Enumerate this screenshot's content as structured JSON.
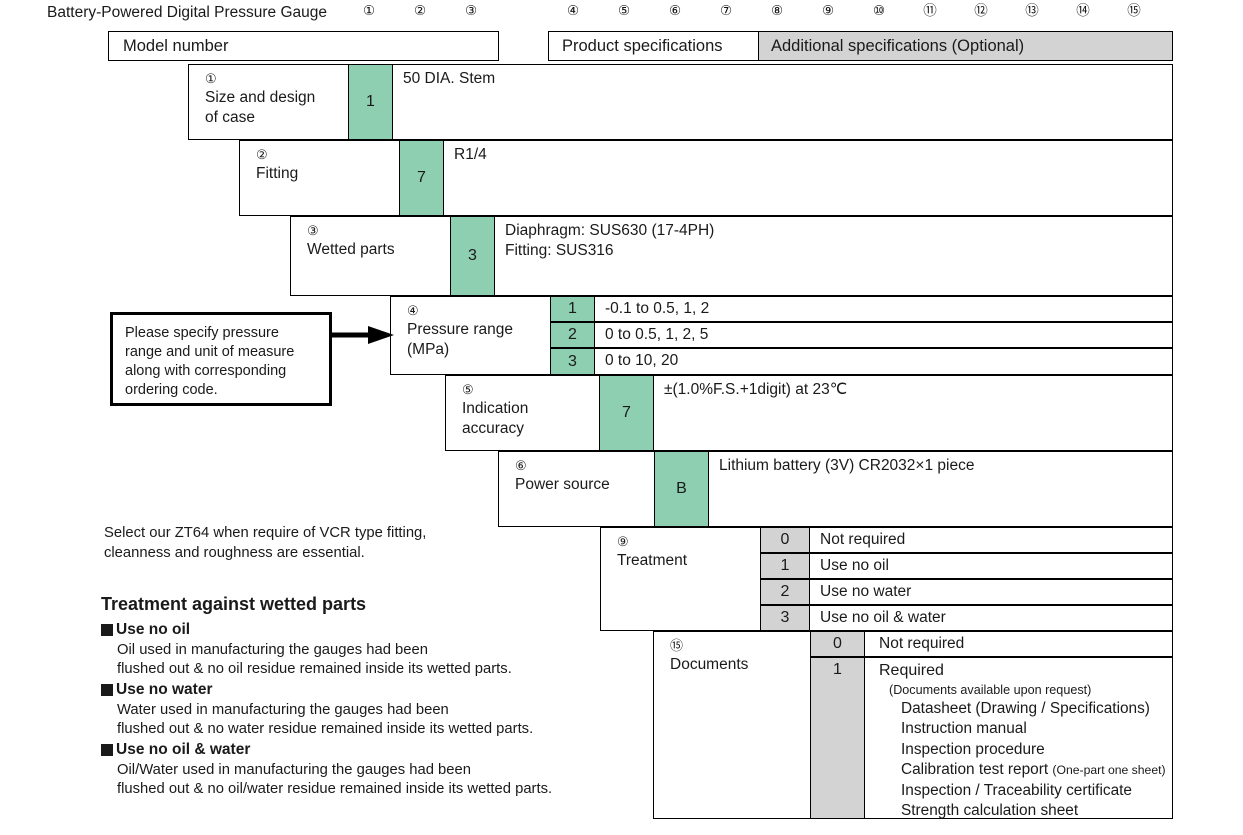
{
  "header": {
    "title": "Battery-Powered Digital Pressure Gauge",
    "circled_markers": [
      "①",
      "②",
      "③",
      "④",
      "⑤",
      "⑥",
      "⑦",
      "⑧",
      "⑨",
      "⑩",
      "⑪",
      "⑫",
      "⑬",
      "⑭",
      "⑮"
    ],
    "model_number_label": "Model number",
    "product_specifications_label": "Product specifications",
    "additional_specifications_label": "Additional specifications (Optional)"
  },
  "colors": {
    "code_green": "#8ecfb2",
    "code_gray": "#d3d3d3",
    "border": "#000000"
  },
  "spec_rows": [
    {
      "marker": "①",
      "label": "Size and design\nof case",
      "code_style": "green",
      "options": [
        {
          "code": "1",
          "desc": "50 DIA. Stem"
        }
      ]
    },
    {
      "marker": "②",
      "label": "Fitting",
      "code_style": "green",
      "options": [
        {
          "code": "7",
          "desc": "R1/4"
        }
      ]
    },
    {
      "marker": "③",
      "label": "Wetted parts",
      "code_style": "green",
      "options": [
        {
          "code": "3",
          "desc": "Diaphragm: SUS630 (17-4PH)\nFitting: SUS316"
        }
      ]
    },
    {
      "marker": "④",
      "label": "Pressure range\n(MPa)",
      "code_style": "green",
      "options": [
        {
          "code": "1",
          "desc": "-0.1 to 0.5, 1, 2"
        },
        {
          "code": "2",
          "desc": "0 to 0.5, 1, 2, 5"
        },
        {
          "code": "3",
          "desc": "0 to 10, 20"
        }
      ]
    },
    {
      "marker": "⑤",
      "label": "Indication\naccuracy",
      "code_style": "green",
      "options": [
        {
          "code": "7",
          "desc": "±(1.0%F.S.+1digit) at 23℃"
        }
      ]
    },
    {
      "marker": "⑥",
      "label": "Power source",
      "code_style": "green",
      "options": [
        {
          "code": "B",
          "desc": "Lithium battery (3V) CR2032×1 piece"
        }
      ]
    },
    {
      "marker": "⑨",
      "label": "Treatment",
      "code_style": "gray",
      "options": [
        {
          "code": "0",
          "desc": "Not required"
        },
        {
          "code": "1",
          "desc": "Use no oil"
        },
        {
          "code": "2",
          "desc": "Use no water"
        },
        {
          "code": "3",
          "desc": "Use no oil & water"
        }
      ]
    }
  ],
  "documents_row": {
    "marker": "⑮",
    "label": "Documents",
    "code_style": "gray",
    "option_not_required": {
      "code": "0",
      "desc": "Not required"
    },
    "option_required": {
      "code": "1",
      "title": "Required",
      "note": "(Documents available upon request)",
      "items": [
        {
          "text": "Datasheet (Drawing / Specifications)",
          "suffix": ""
        },
        {
          "text": "Instruction manual",
          "suffix": ""
        },
        {
          "text": "Inspection procedure",
          "suffix": ""
        },
        {
          "text": "Calibration test report",
          "suffix": "(One-part one sheet)"
        },
        {
          "text": "Inspection / Traceability certificate",
          "suffix": ""
        },
        {
          "text": "Strength calculation sheet",
          "suffix": ""
        }
      ]
    }
  },
  "callout": {
    "text": "Please specify pressure\nrange and unit of measure\nalong with corresponding\nordering code."
  },
  "notes": {
    "zt64": "Select our ZT64 when require of VCR type fitting,\ncleanness and roughness are essential.",
    "treatment_heading": "Treatment against wetted parts",
    "treatment_items": [
      {
        "term": "Use no oil",
        "desc": "Oil used in manufacturing the gauges had been\nflushed out & no oil residue remained inside its wetted parts."
      },
      {
        "term": "Use no water",
        "desc": "Water used in manufacturing the gauges had been\nflushed out & no water residue remained inside its wetted parts."
      },
      {
        "term": "Use no oil & water",
        "desc": "Oil/Water used in manufacturing the gauges had been\nflushed out & no oil/water residue remained inside its wetted parts."
      }
    ]
  }
}
